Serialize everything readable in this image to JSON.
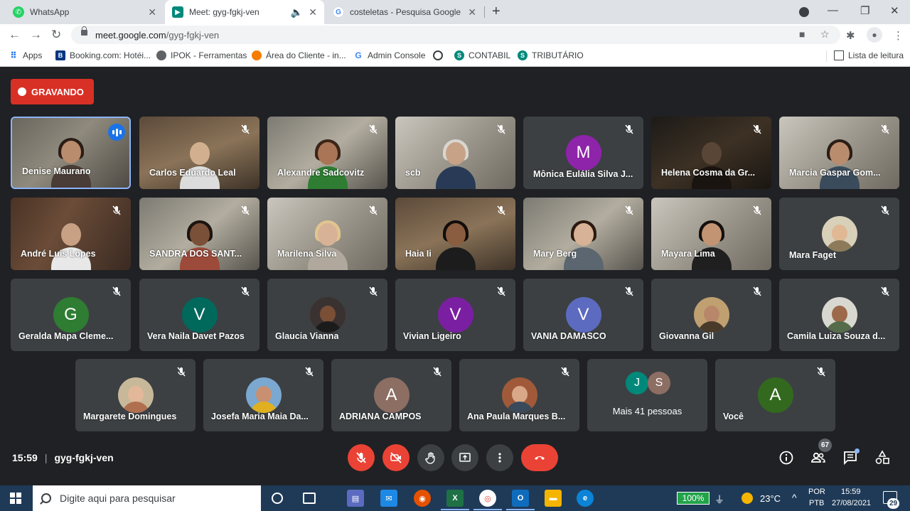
{
  "browser": {
    "tabs": [
      {
        "title": "WhatsApp",
        "favicon": "whatsapp-icon",
        "color": "#25d366"
      },
      {
        "title": "Meet: gyg-fgkj-ven",
        "favicon": "meet-icon",
        "color": "#00897b",
        "active": true
      },
      {
        "title": "costeletas - Pesquisa Google",
        "favicon": "google-icon",
        "color": "#4285f4"
      }
    ],
    "url_host": "meet.google.com",
    "url_path": "/gyg-fgkj-ven",
    "bookmarks": [
      {
        "label": "Apps",
        "icon": "apps-grid-icon"
      },
      {
        "label": "Booking.com: Hotéi...",
        "icon": "booking-icon"
      },
      {
        "label": "IPOK - Ferramentas",
        "icon": "globe-icon"
      },
      {
        "label": "Área do Cliente - in...",
        "icon": "orange-logo-icon"
      },
      {
        "label": "Admin Console",
        "icon": "google-icon"
      },
      {
        "label": "",
        "icon": "spiral-icon"
      },
      {
        "label": "CONTABIL",
        "icon": "s-logo-icon"
      },
      {
        "label": "TRIBUTÁRIO",
        "icon": "s-logo-icon"
      }
    ],
    "reading_list": "Lista de leitura"
  },
  "meet": {
    "recording_label": "GRAVANDO",
    "time": "15:59",
    "meeting_code": "gyg-fgkj-ven",
    "participants_count": "67",
    "accent_red": "#ea4335",
    "participants": [
      {
        "name": "Denise Maurano",
        "type": "video",
        "speaking": true
      },
      {
        "name": "Carlos Eduardo Leal",
        "type": "video"
      },
      {
        "name": "Alexandre Sadcovitz",
        "type": "video"
      },
      {
        "name": "scb",
        "type": "video"
      },
      {
        "name": "Mônica Eulália Silva J...",
        "type": "initial",
        "initial": "M",
        "color": "#8e24aa"
      },
      {
        "name": "Helena Cosma da Gr...",
        "type": "video"
      },
      {
        "name": "Marcia Gaspar Gom...",
        "type": "video"
      },
      {
        "name": "André Luis Lopes",
        "type": "video"
      },
      {
        "name": "SANDRA DOS SANT...",
        "type": "video"
      },
      {
        "name": "Marilena Silva",
        "type": "video"
      },
      {
        "name": "Haia Ii",
        "type": "video"
      },
      {
        "name": "Mary Berg",
        "type": "video"
      },
      {
        "name": "Mayara Lima",
        "type": "video"
      },
      {
        "name": "Mara Faget",
        "type": "photo"
      },
      {
        "name": "Geralda Mapa Cleme...",
        "type": "initial",
        "initial": "G",
        "color": "#2e7d32"
      },
      {
        "name": "Vera Naila Davet Pazos",
        "type": "initial",
        "initial": "V",
        "color": "#00695c"
      },
      {
        "name": "Glaucia Vianna",
        "type": "photo"
      },
      {
        "name": "Vivian Ligeiro",
        "type": "initial",
        "initial": "V",
        "color": "#7b1fa2"
      },
      {
        "name": "VANIA DAMASCO",
        "type": "initial",
        "initial": "V",
        "color": "#5c6bc0"
      },
      {
        "name": "Giovanna Gil",
        "type": "photo"
      },
      {
        "name": "Camila Luiza Souza d...",
        "type": "photo"
      },
      {
        "name": "Margarete Domingues",
        "type": "photo"
      },
      {
        "name": "Josefa Maria Maia Da...",
        "type": "photo"
      },
      {
        "name": "ADRIANA CAMPOS",
        "type": "initial",
        "initial": "A",
        "color": "#8d6e63"
      },
      {
        "name": "Ana Paula Marques B...",
        "type": "photo"
      },
      {
        "name": "Mais 41 pessoas",
        "type": "more",
        "avatars": [
          {
            "initial": "J",
            "color": "#00897b"
          },
          {
            "initial": "S",
            "color": "#8d6e63"
          }
        ]
      },
      {
        "name": "Você",
        "type": "initial",
        "initial": "A",
        "color": "#33691e"
      }
    ]
  },
  "taskbar": {
    "search_placeholder": "Digite aqui para pesquisar",
    "battery": "100%",
    "temperature": "23°C",
    "lang_top": "POR",
    "lang_bottom": "PTB",
    "clock_time": "15:59",
    "clock_date": "27/08/2021",
    "notifications": "29"
  }
}
